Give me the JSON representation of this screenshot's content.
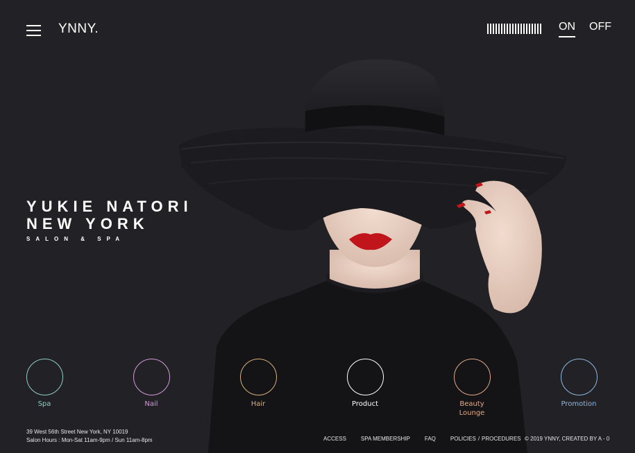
{
  "header": {
    "logo": "YNNY.",
    "toggle_on": "ON",
    "toggle_off": "OFF",
    "menu_icon": "hamburger-menu-icon",
    "sound_icon": "sound-bars-icon"
  },
  "hero": {
    "title_line1": "YUKIE NATORI",
    "title_line2": "NEW YORK",
    "subtitle": "SALON & SPA"
  },
  "categories": [
    {
      "label": "Spa",
      "color": "#8fd0c4"
    },
    {
      "label": "Nail",
      "color": "#d49ad8"
    },
    {
      "label": "Hair",
      "color": "#d6b27c"
    },
    {
      "label": "Product",
      "color": "#ffffff"
    },
    {
      "label": "Beauty",
      "label2": "Lounge",
      "color": "#e2a989"
    },
    {
      "label": "Promotion",
      "color": "#8fb9e0"
    }
  ],
  "footer": {
    "address_line1": "39 West 56th Street New York, NY 10019",
    "address_line2": "Salon Hours : Mon-Sat 11am-9pm / Sun 11am-8pm",
    "links": {
      "access": "ACCESS",
      "spa_membership": "SPA MEMBERSHIP",
      "faq": "FAQ",
      "policies": "POLICIES",
      "divider": "/",
      "procedures": "PROCEDURES"
    },
    "copyright": "© 2019 YNNY,  CREATED BY A - 0"
  },
  "colors": {
    "background": "#222126",
    "lips": "#c0161b"
  }
}
